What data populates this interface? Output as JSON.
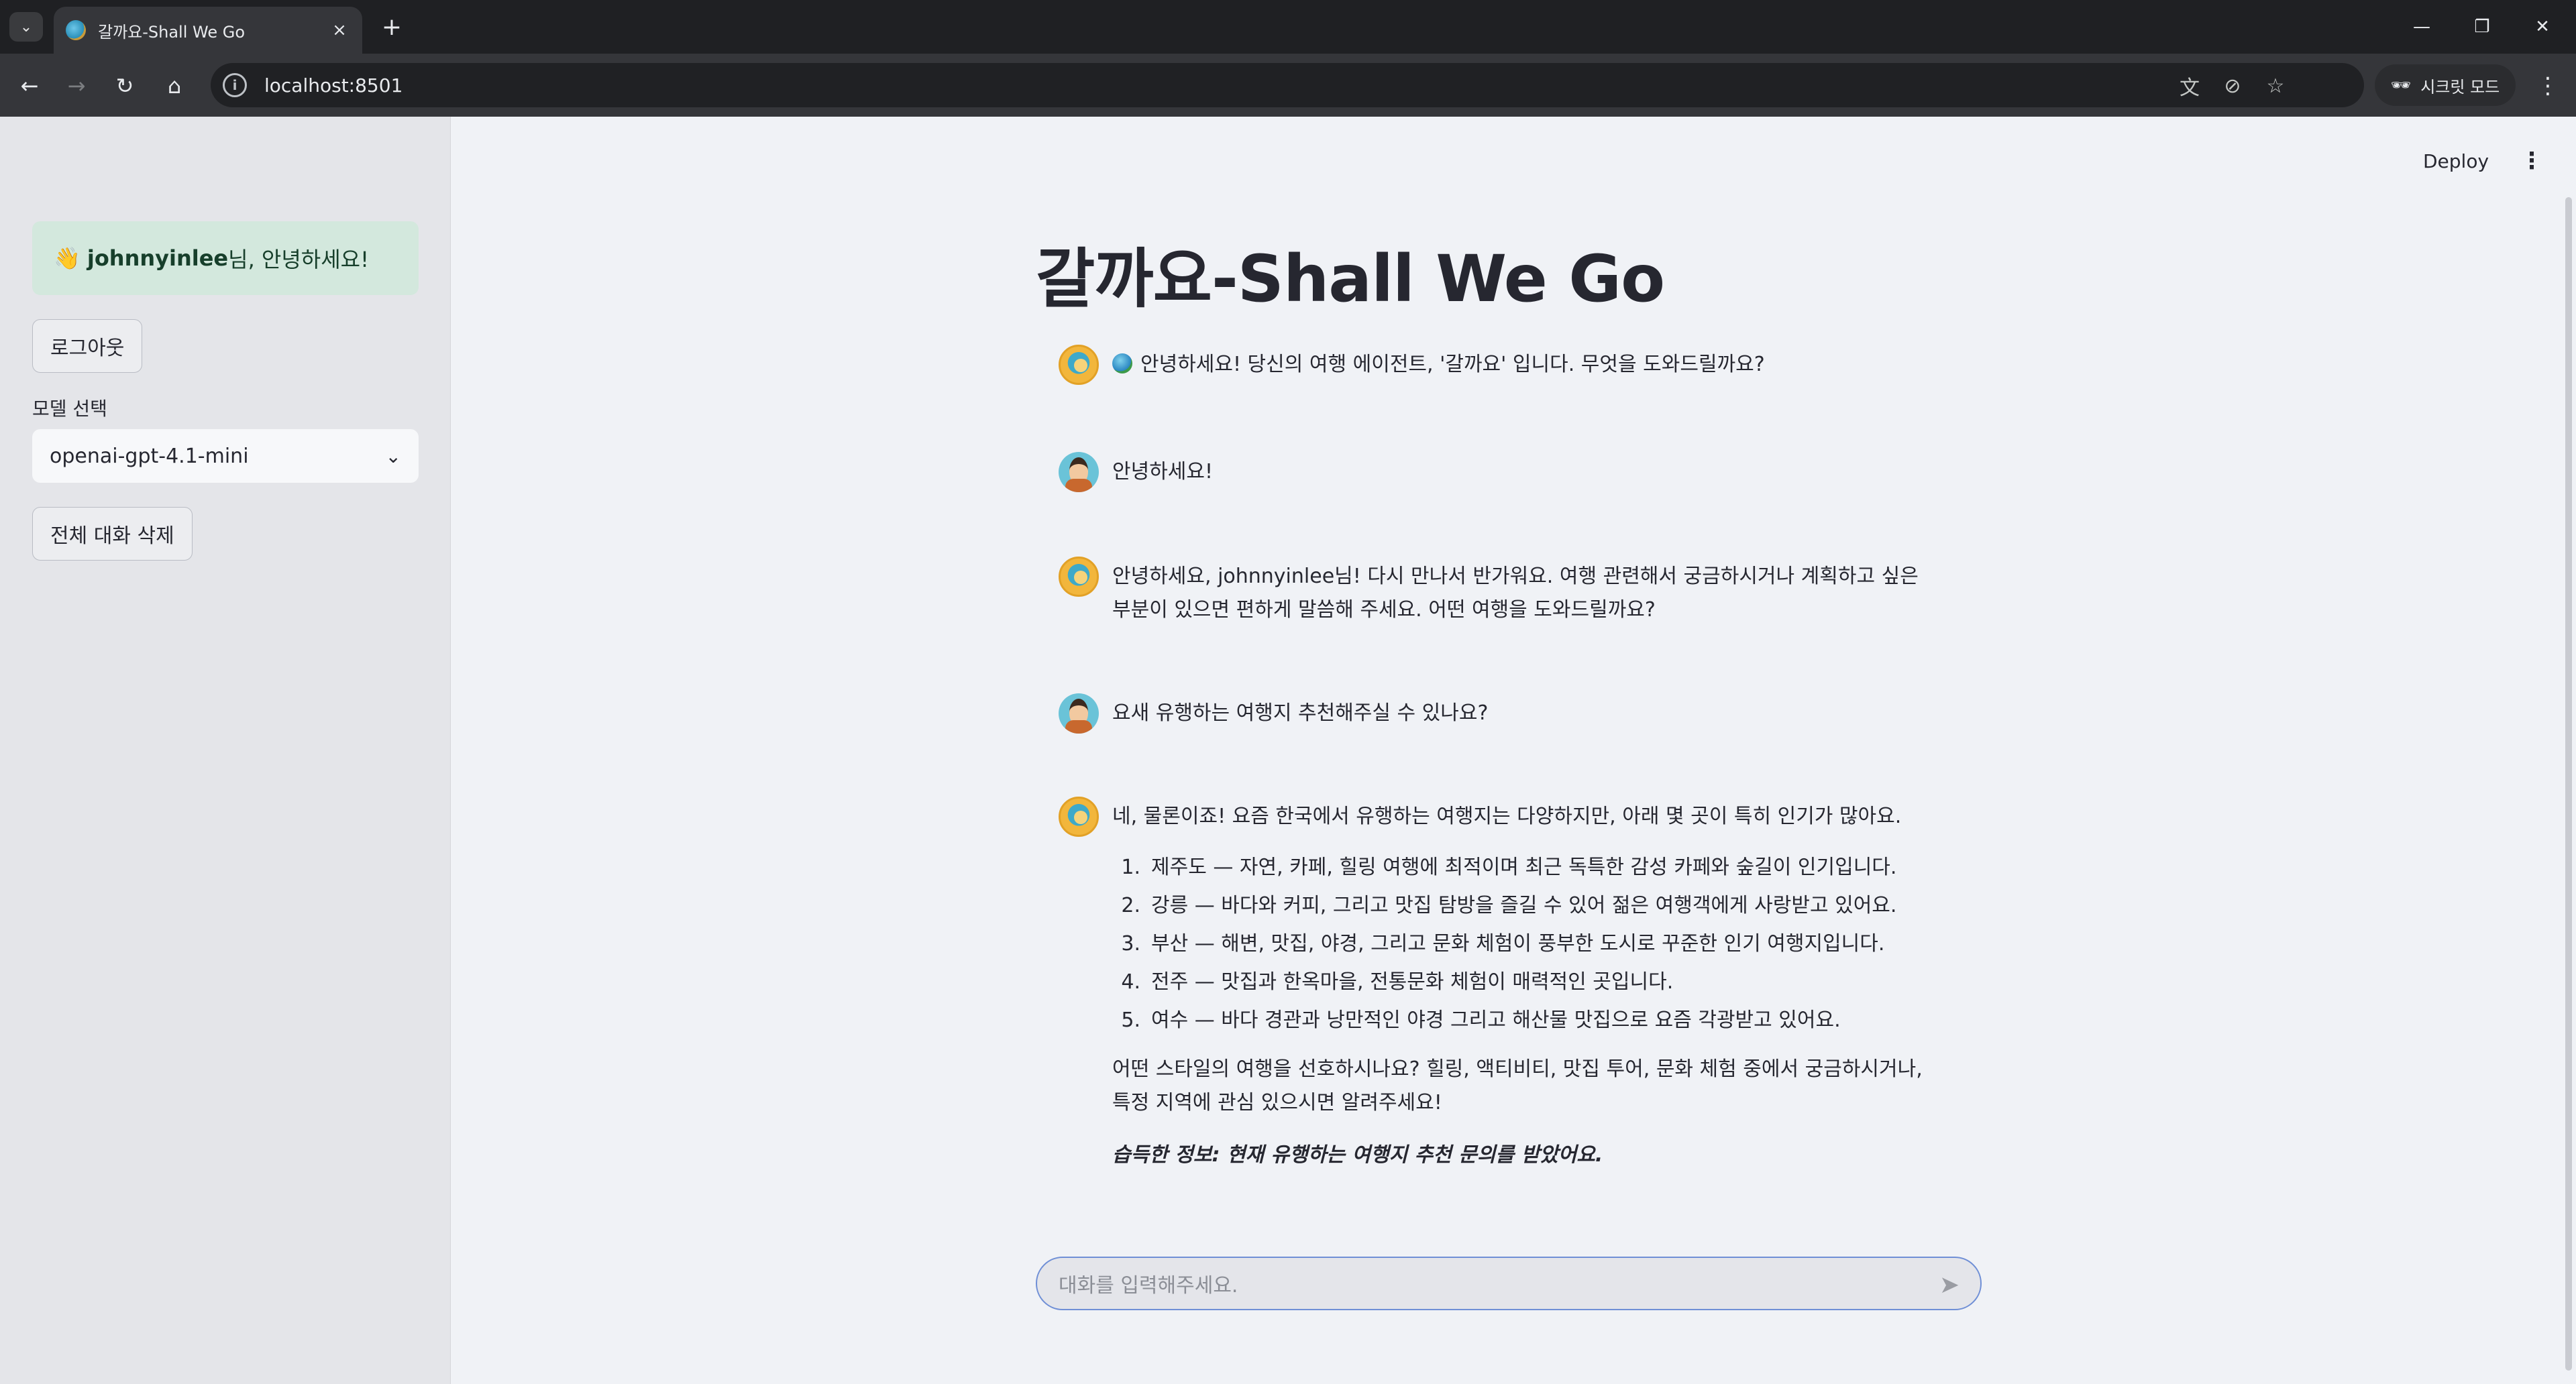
{
  "browser": {
    "tab_title": "갈까요-Shall We Go",
    "url": "localhost:8501",
    "incognito_label": "시크릿 모드"
  },
  "sidebar": {
    "greeting_user": "johnnyinlee",
    "greeting_suffix": "님, 안녕하세요!",
    "logout_label": "로그아웃",
    "model_label": "모델 선택",
    "model_selected": "openai-gpt-4.1-mini",
    "clear_label": "전체 대화 삭제"
  },
  "header": {
    "deploy_label": "Deploy"
  },
  "main": {
    "title": "갈까요-Shall We Go",
    "messages": [
      {
        "role": "assistant",
        "text": "안녕하세요! 당신의 여행 에이전트, '갈까요' 입니다. 무엇을 도와드릴까요?"
      },
      {
        "role": "user",
        "text": "안녕하세요!"
      },
      {
        "role": "assistant",
        "text": "안녕하세요, johnnyinlee님! 다시 만나서 반가워요. 여행 관련해서 궁금하시거나 계획하고 싶은 부분이 있으면 편하게 말씀해 주세요. 어떤 여행을 도와드릴까요?"
      },
      {
        "role": "user",
        "text": "요새 유행하는 여행지 추천해주실 수 있나요?"
      },
      {
        "role": "assistant",
        "intro": "네, 물론이죠! 요즘 한국에서 유행하는 여행지는 다양하지만, 아래 몇 곳이 특히 인기가 많아요.",
        "items": [
          {
            "num": "1.",
            "text": "제주도 — 자연, 카페, 힐링 여행에 최적이며 최근 독특한 감성 카페와 숲길이 인기입니다."
          },
          {
            "num": "2.",
            "text": "강릉 — 바다와 커피, 그리고 맛집 탐방을 즐길 수 있어 젊은 여행객에게 사랑받고 있어요."
          },
          {
            "num": "3.",
            "text": "부산 — 해변, 맛집, 야경, 그리고 문화 체험이 풍부한 도시로 꾸준한 인기 여행지입니다."
          },
          {
            "num": "4.",
            "text": "전주 — 맛집과 한옥마을, 전통문화 체험이 매력적인 곳입니다."
          },
          {
            "num": "5.",
            "text": "여수 — 바다 경관과 낭만적인 야경 그리고 해산물 맛집으로 요즘 각광받고 있어요."
          }
        ],
        "followup": "어떤 스타일의 여행을 선호하시나요? 힐링, 액티비티, 맛집 투어, 문화 체험 중에서 궁금하시거나, 특정 지역에 관심 있으시면 알려주세요!",
        "learned": "습득한 정보: 현재 유행하는 여행지 추천 문의를 받았어요."
      }
    ],
    "input_placeholder": "대화를 입력해주세요."
  }
}
